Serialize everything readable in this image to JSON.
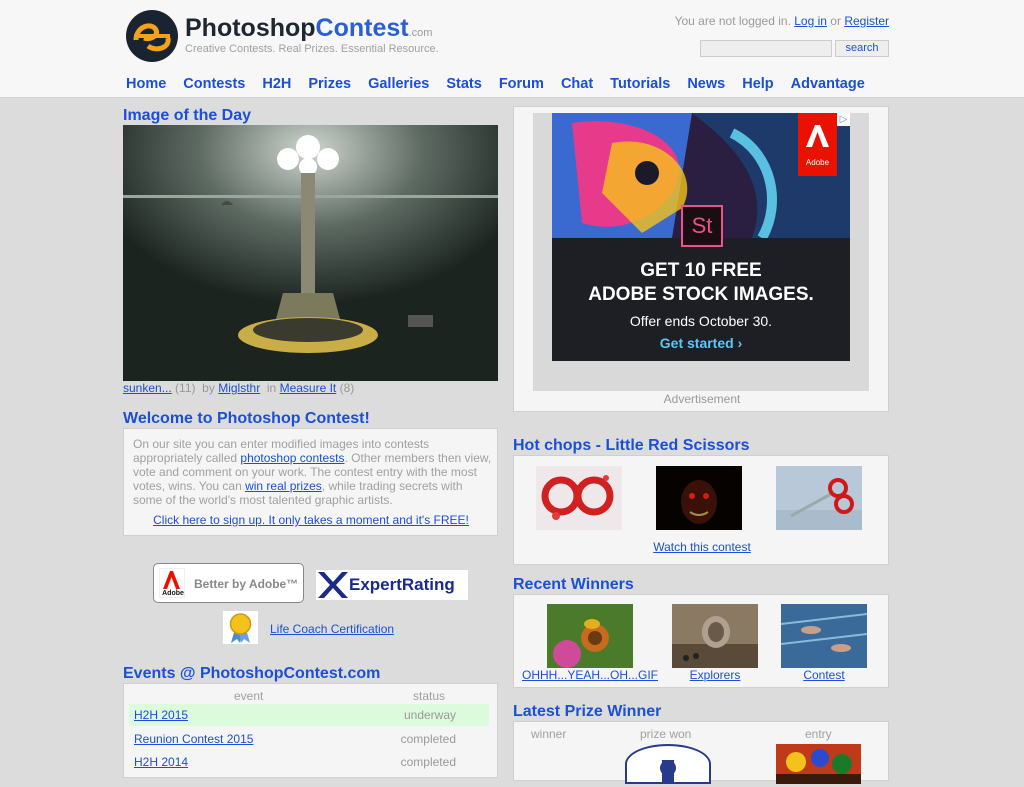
{
  "header": {
    "brand_main": "Photoshop",
    "brand_accent": "Contest",
    "brand_domain": ".com",
    "tagline": "Creative Contests. Real Prizes. Essential Resource.",
    "login_prefix": "You are not logged in.",
    "login_link": "Log in",
    "login_or": "or",
    "register_link": "Register",
    "search_label": "search",
    "search_value": ""
  },
  "nav": [
    "Home",
    "Contests",
    "H2H",
    "Prizes",
    "Galleries",
    "Stats",
    "Forum",
    "Chat",
    "Tutorials",
    "News",
    "Help",
    "Advantage"
  ],
  "iotd": {
    "title": "Image of the Day",
    "entry": "sunken...",
    "entry_count": "(11)",
    "by": "by",
    "author": "Miglsthr",
    "in": "in",
    "contest": "Measure It",
    "contest_count": "(8)"
  },
  "welcome": {
    "title": "Welcome to Photoshop Contest!",
    "t1": "On our site you can enter modified images into contests appropriately called ",
    "link1": "photoshop contests",
    "t2": ". Other members then view, vote and comment on your work. The contest entry with the most votes, wins. You can ",
    "link2": "win real prizes",
    "t3": ", while trading secrets with some of the world's most talented graphic artists.",
    "signup": "Click here to sign up. It only takes a moment and it's FREE!"
  },
  "partners": {
    "adobe_label": "Better by Adobe™",
    "adobe_logo": "Adobe",
    "xr_label": "ExpertRating",
    "lifecoach": "Life Coach Certification"
  },
  "events": {
    "title": "Events @ PhotoshopContest.com",
    "col_event": "event",
    "col_status": "status",
    "rows": [
      {
        "name": "H2H 2015",
        "status": "underway"
      },
      {
        "name": "Reunion Contest 2015",
        "status": "completed"
      },
      {
        "name": "H2H 2014",
        "status": "completed"
      }
    ]
  },
  "ad": {
    "brand": "Adobe",
    "st": "St",
    "headline1": "GET 10 FREE",
    "headline2": "ADOBE STOCK IMAGES.",
    "offer": "Offer ends October 30.",
    "cta": "Get started ›",
    "label": "Advertisement"
  },
  "hotchops": {
    "title": "Hot chops - Little Red Scissors",
    "watch": "Watch this contest"
  },
  "winners": {
    "title": "Recent Winners",
    "items": [
      "OHHH...YEAH...OH...GIF",
      "Explorers",
      "Contest"
    ]
  },
  "prize": {
    "title": "Latest Prize Winner",
    "col_winner": "winner",
    "col_prize": "prize won",
    "col_entry": "entry"
  },
  "colors": {
    "accent": "#1a4fd6",
    "brand_dark": "#1e2632",
    "logo_orange": "#f5a21b",
    "adobe_red": "#eb1000"
  }
}
